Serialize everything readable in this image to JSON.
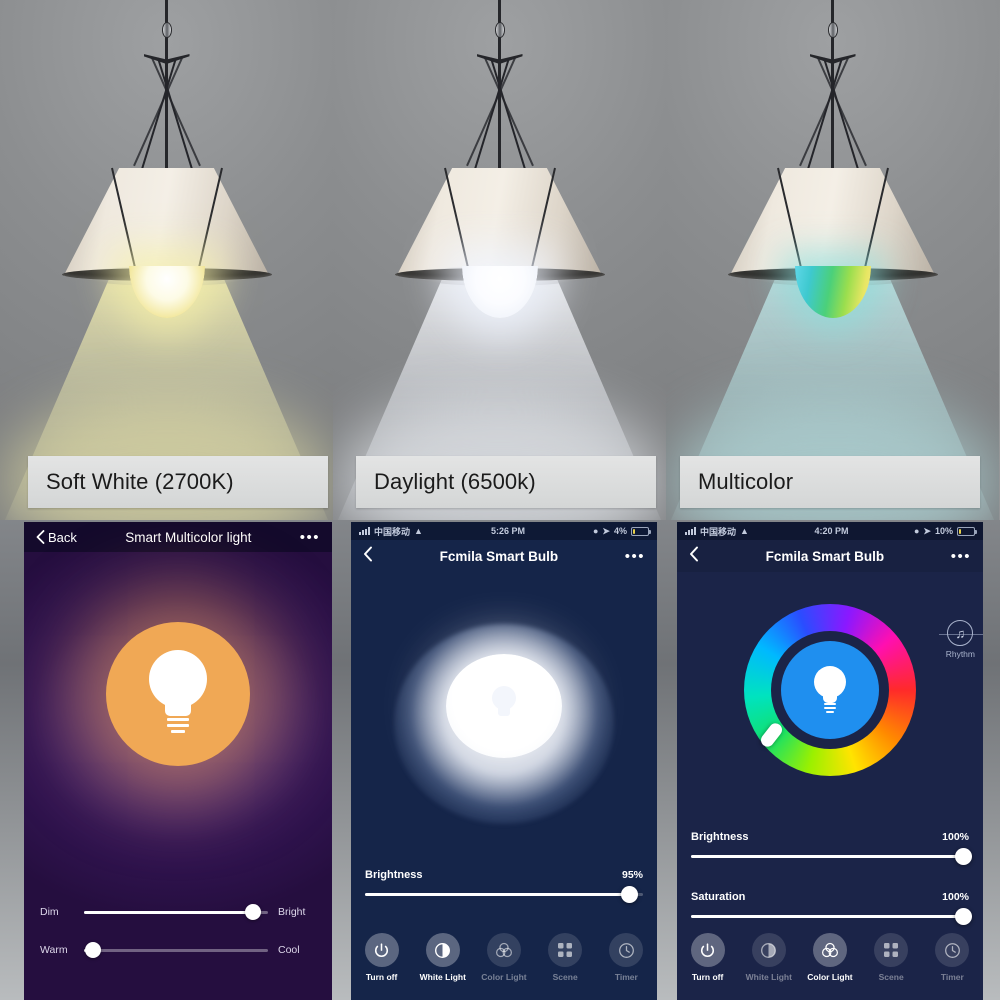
{
  "product": {
    "panels": [
      {
        "caption": "Soft White (2700K)",
        "mode": "warm"
      },
      {
        "caption": "Daylight (6500k)",
        "mode": "cool"
      },
      {
        "caption": "Multicolor",
        "mode": "multi"
      }
    ]
  },
  "phone1": {
    "nav": {
      "back_label": "Back",
      "title": "Smart Multicolor light",
      "more": "•••"
    },
    "bulb_icon": "bulb-icon",
    "sliders": [
      {
        "left_label": "Dim",
        "right_label": "Bright",
        "percent": 92
      },
      {
        "left_label": "Warm",
        "right_label": "Cool",
        "percent": 4
      }
    ]
  },
  "phone2": {
    "statusbar": {
      "carrier": "中国移动",
      "time": "5:26 PM",
      "battery": "4%"
    },
    "nav": {
      "title": "Fcmila Smart Bulb",
      "more": "•••"
    },
    "sliders": [
      {
        "name": "Brightness",
        "value": "95%",
        "percent": 95
      }
    ],
    "toolbar": [
      {
        "label": "Turn off",
        "icon": "power-icon",
        "active": true
      },
      {
        "label": "White Light",
        "icon": "half-circle-icon",
        "active": true
      },
      {
        "label": "Color Light",
        "icon": "color-circles-icon",
        "active": false
      },
      {
        "label": "Scene",
        "icon": "grid-squares-icon",
        "active": false
      },
      {
        "label": "Timer",
        "icon": "clock-icon",
        "active": false
      }
    ]
  },
  "phone3": {
    "statusbar": {
      "carrier": "中国移动",
      "time": "4:20 PM",
      "battery": "10%"
    },
    "nav": {
      "title": "Fcmila Smart Bulb",
      "more": "•••"
    },
    "rhythm": {
      "label": "Rhythm",
      "icon": "music-note-icon"
    },
    "color_wheel": {
      "selected_color": "#1f8fef",
      "icon": "bulb-icon"
    },
    "sliders": [
      {
        "name": "Brightness",
        "value": "100%",
        "percent": 100
      },
      {
        "name": "Saturation",
        "value": "100%",
        "percent": 100
      }
    ],
    "toolbar": [
      {
        "label": "Turn off",
        "icon": "power-icon",
        "active": true
      },
      {
        "label": "White Light",
        "icon": "half-circle-icon",
        "active": false
      },
      {
        "label": "Color Light",
        "icon": "color-circles-icon",
        "active": true
      },
      {
        "label": "Scene",
        "icon": "grid-squares-icon",
        "active": false
      },
      {
        "label": "Timer",
        "icon": "clock-icon",
        "active": false
      }
    ]
  },
  "colors": {
    "purple_ui": "#2a1049",
    "navy_ui": "#152549",
    "accent_orange": "#f0a855",
    "accent_blue": "#1f8fef"
  }
}
